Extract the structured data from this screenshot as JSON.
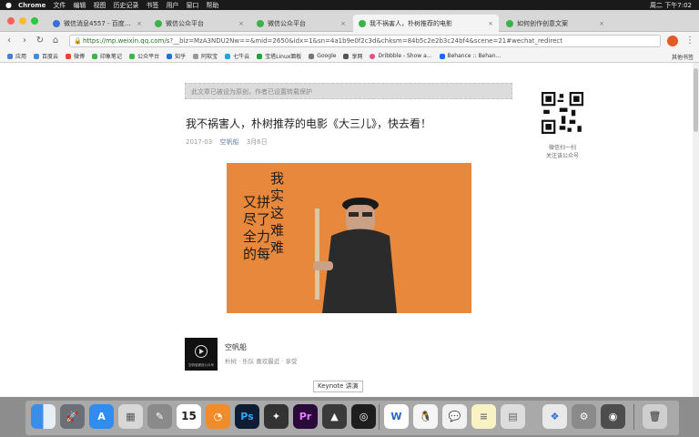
{
  "menubar": {
    "app_name": "Chrome",
    "items": [
      "文件",
      "编辑",
      "视图",
      "历史记录",
      "书签",
      "用户",
      "窗口",
      "帮助"
    ],
    "clock": "周二 下午7:02"
  },
  "tabs": [
    {
      "label": "微信消息4557 - 百度搜索"
    },
    {
      "label": "微信公众平台"
    },
    {
      "label": "微信公众平台"
    },
    {
      "label": "我不祸害人，朴树推荐的电影"
    },
    {
      "label": "如何创作创意文案"
    }
  ],
  "address": {
    "secure_prefix": "https://mp.weixin.qq.com",
    "rest": "/s?__biz=MzA3NDU2Nw==&mid=2650&idx=1&sn=4a1b9e0f2c3d&chksm=84b5c2e2b3c24bf4&scene=21#wechat_redirect"
  },
  "bookmarks": {
    "items": [
      "应用",
      "百度云",
      "微博",
      "印象笔记",
      "公众平台",
      "知乎",
      "阿软宝",
      "七牛云",
      "宝塔Linux面板",
      "Google",
      "享网",
      "Dribbble - Show a...",
      "Behance :: Behan..."
    ],
    "other_label": "其他书签"
  },
  "article": {
    "notice": "此文章已被设为原创，作者已设置转载保护",
    "title": "我不祸害人，朴树推荐的电影《大三儿》，快去看！",
    "meta_left": "2017-03",
    "author": "空帆船",
    "date": "3月6日",
    "cover_calligraphy_left": "又拼尽了全力的每",
    "cover_calligraphy_right": "我实这难难"
  },
  "qr": {
    "caption_line1": "微信扫一扫",
    "caption_line2": "关注该公众号"
  },
  "account": {
    "name": "空帆船",
    "description": "朴树 · 乐队 喜欢最近 · 享受",
    "logo_text": "空帆船微信公众号"
  },
  "tooltip": "Keynote 讲演",
  "colors": {
    "accent": "#e8883c",
    "link": "#607fa6",
    "menubar": "#1a1a1a"
  },
  "dock": {
    "icons": [
      "finder-icon",
      "launchpad-icon",
      "app-store-icon",
      "preview-icon",
      "system-tool-icon",
      "calendar-icon",
      "app-icon-orange",
      "photoshop-icon",
      "puzzle-icon",
      "premiere-icon",
      "keynote-icon",
      "quicktime-icon",
      "wps-icon",
      "qq-icon",
      "wechat-icon",
      "notes-icon",
      "image-viewer-icon",
      "app-chain-icon",
      "system-prefs-icon",
      "hard-disk-icon",
      "trash-icon"
    ],
    "calendar_day": "15",
    "photoshop_label": "Ps",
    "premiere_label": "Pr",
    "wps_label": "W"
  }
}
